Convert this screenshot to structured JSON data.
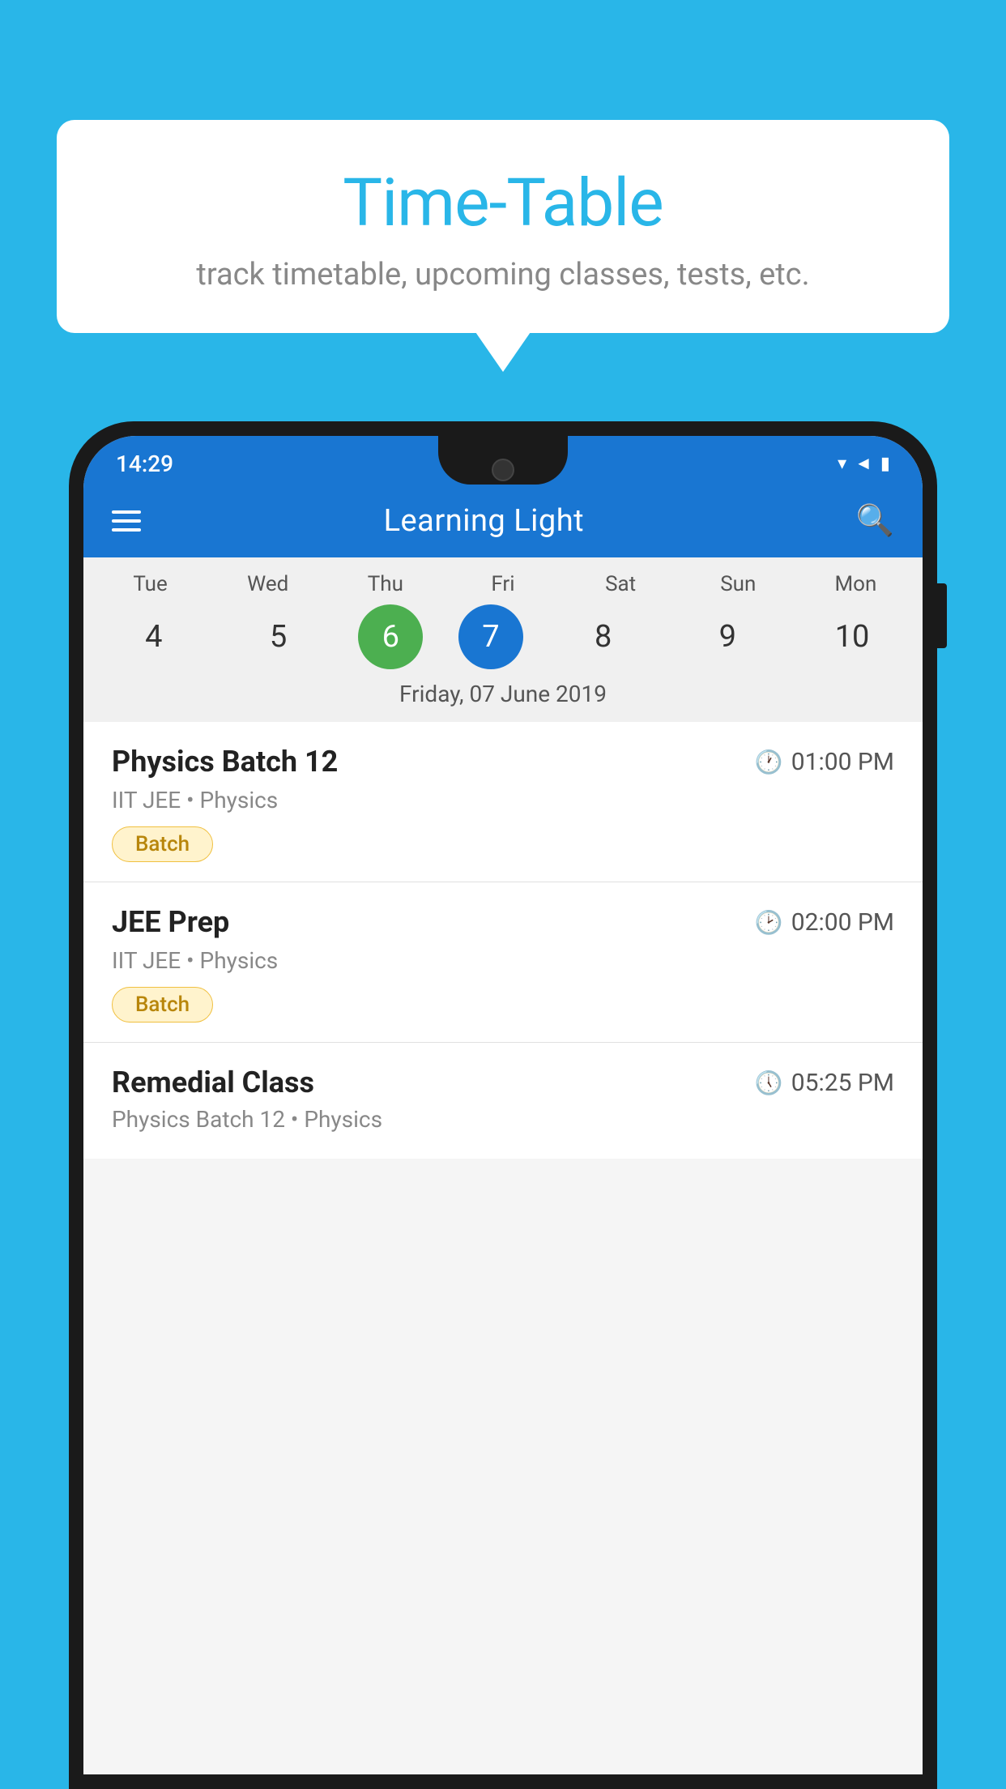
{
  "background_color": "#29B6E8",
  "bubble": {
    "title": "Time-Table",
    "subtitle": "track timetable, upcoming classes, tests, etc."
  },
  "phone": {
    "status_bar": {
      "time": "14:29"
    },
    "app_bar": {
      "title": "Learning Light"
    },
    "calendar": {
      "days": [
        {
          "label": "Tue",
          "number": "4"
        },
        {
          "label": "Wed",
          "number": "5"
        },
        {
          "label": "Thu",
          "number": "6",
          "state": "today"
        },
        {
          "label": "Fri",
          "number": "7",
          "state": "selected"
        },
        {
          "label": "Sat",
          "number": "8"
        },
        {
          "label": "Sun",
          "number": "9"
        },
        {
          "label": "Mon",
          "number": "10"
        }
      ],
      "selected_date": "Friday, 07 June 2019"
    },
    "schedule": [
      {
        "name": "Physics Batch 12",
        "time": "01:00 PM",
        "sub": "IIT JEE • Physics",
        "badge": "Batch"
      },
      {
        "name": "JEE Prep",
        "time": "02:00 PM",
        "sub": "IIT JEE • Physics",
        "badge": "Batch"
      },
      {
        "name": "Remedial Class",
        "time": "05:25 PM",
        "sub": "Physics Batch 12 • Physics",
        "badge": null
      }
    ]
  }
}
